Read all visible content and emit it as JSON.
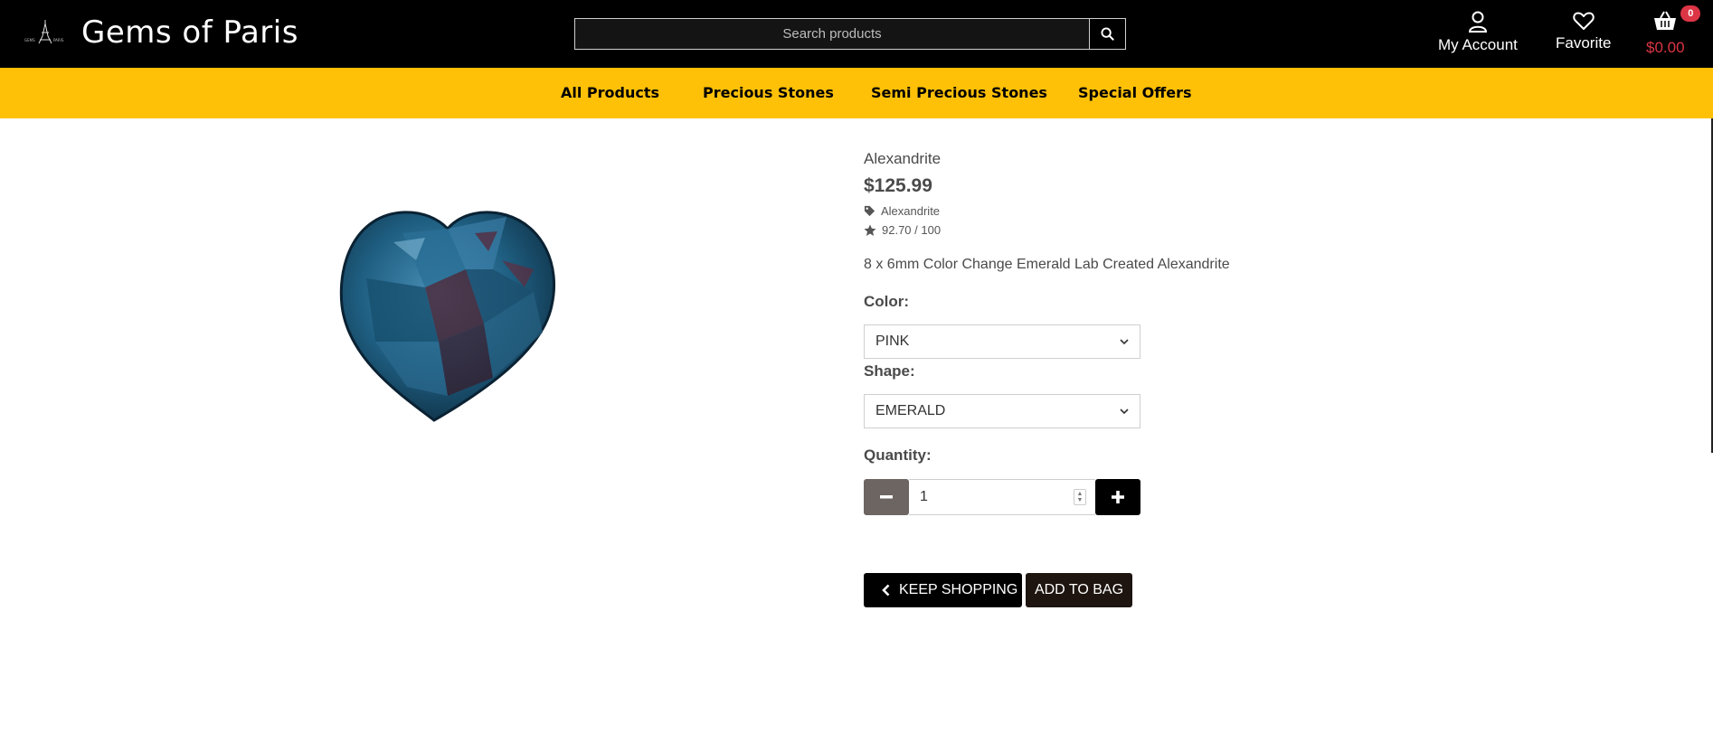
{
  "header": {
    "brand": "Gems of Paris",
    "search_placeholder": "Search products",
    "account_label": "My Account",
    "favorite_label": "Favorite",
    "cart_total": "$0.00",
    "cart_count": "0"
  },
  "nav": {
    "items": [
      {
        "label": "All Products"
      },
      {
        "label": "Precious Stones"
      },
      {
        "label": "Semi Precious Stones"
      },
      {
        "label": "Special Offers"
      }
    ]
  },
  "product": {
    "name": "Alexandrite",
    "price": "$125.99",
    "category": "Alexandrite",
    "rating": "92.70 / 100",
    "description": "8 x 6mm Color Change Emerald Lab Created Alexandrite",
    "color_label": "Color:",
    "color_value": "PINK",
    "shape_label": "Shape:",
    "shape_value": "EMERALD",
    "quantity_label": "Quantity:",
    "quantity_value": "1"
  },
  "actions": {
    "keep_shopping": "KEEP SHOPPING",
    "add_to_bag": "ADD TO BAG"
  },
  "colors": {
    "header_bg": "#000000",
    "nav_bg": "#ffc107",
    "cart_accent": "#dc3545"
  },
  "icons": [
    "eiffel-logo-icon",
    "search-icon",
    "user-icon",
    "heart-icon",
    "basket-icon",
    "tag-icon",
    "star-icon",
    "chevron-down-icon",
    "minus-icon",
    "plus-icon",
    "chevron-left-icon"
  ]
}
